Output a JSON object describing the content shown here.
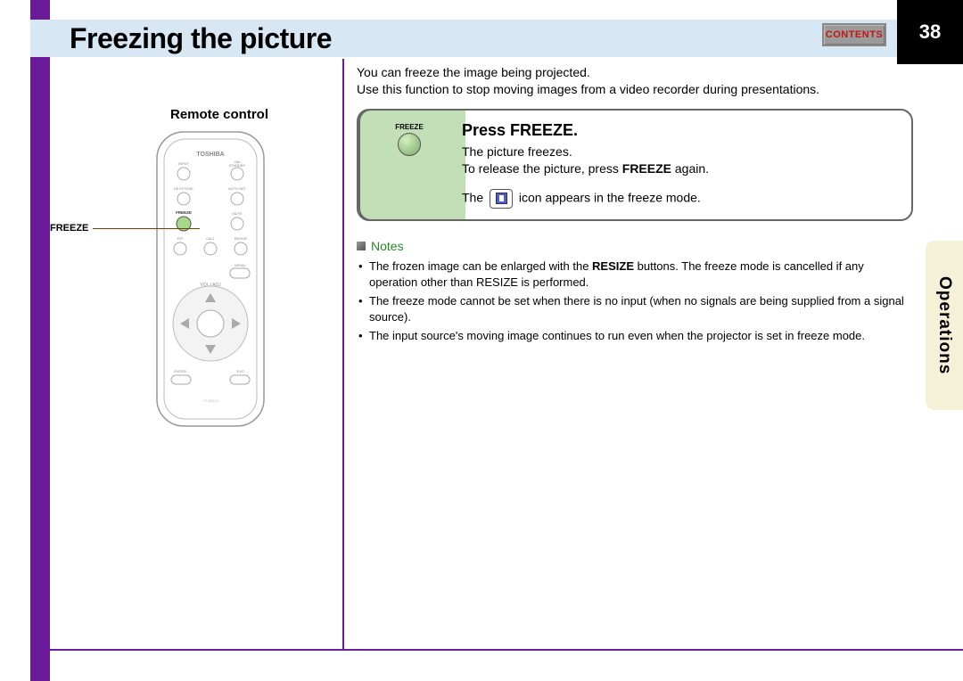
{
  "header": {
    "title": "Freezing the picture",
    "contents_label": "CONTENTS",
    "page_number": "38"
  },
  "side_tab": "Operations",
  "left": {
    "remote_label": "Remote control",
    "freeze_callout": "FREEZE",
    "brand": "TOSHIBA"
  },
  "intro": {
    "line1": "You can freeze the image being projected.",
    "line2": "Use this function to stop moving images from a video recorder during presentations."
  },
  "instruction": {
    "btn_label": "FREEZE",
    "heading": "Press FREEZE.",
    "line1": "The picture freezes.",
    "line2a": "To release the picture, press ",
    "line2b": "FREEZE",
    "line2c": " again.",
    "line3a": "The ",
    "line3b": " icon appears in the freeze mode."
  },
  "notes": {
    "heading": "Notes",
    "items": [
      {
        "a": "The frozen image can be enlarged with the ",
        "b": "RESIZE",
        "c": " buttons. The freeze mode is cancelled if any operation other than RESIZE is performed."
      },
      {
        "a": "The freeze mode cannot be set when there is no input (when no signals are being supplied from a signal source).",
        "b": "",
        "c": ""
      },
      {
        "a": "The input source's moving image continues to run even when the projector is set in freeze mode.",
        "b": "",
        "c": ""
      }
    ]
  }
}
